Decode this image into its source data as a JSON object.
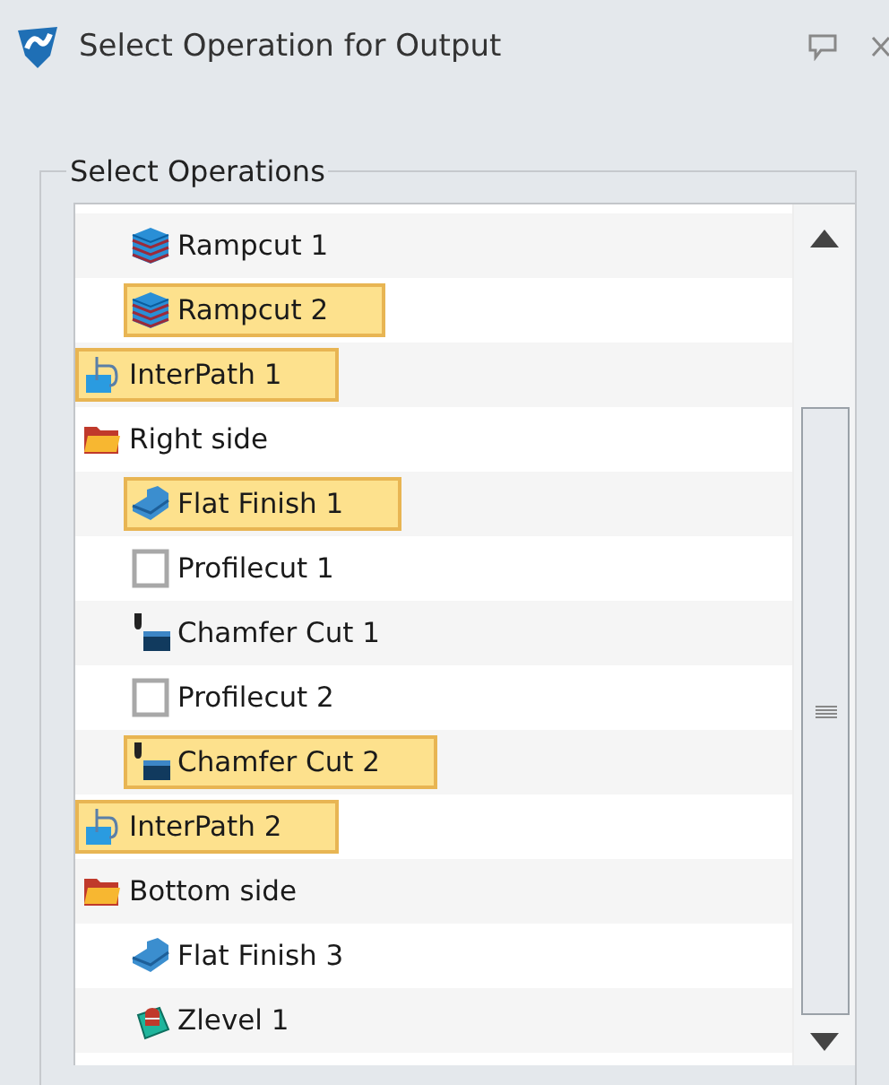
{
  "window": {
    "title": "Select Operation for Output"
  },
  "group": {
    "title": "Select Operations"
  },
  "tree": [
    {
      "children": [
        {
          "label": "Rampcut 1",
          "kind": "ramp",
          "selected": false
        },
        {
          "label": "Rampcut 2",
          "kind": "ramp",
          "selected": true
        }
      ]
    },
    {
      "label": "InterPath 1",
      "kind": "interpath",
      "selected": true
    },
    {
      "label": "Right side",
      "kind": "folder",
      "selected": false,
      "children": [
        {
          "label": "Flat Finish 1",
          "kind": "flat",
          "selected": true
        },
        {
          "label": "Profilecut 1",
          "kind": "profile",
          "selected": false
        },
        {
          "label": "Chamfer Cut 1",
          "kind": "chamfer",
          "selected": false
        },
        {
          "label": "Profilecut 2",
          "kind": "profile",
          "selected": false
        },
        {
          "label": "Chamfer Cut 2",
          "kind": "chamfer",
          "selected": true
        }
      ]
    },
    {
      "label": "InterPath 2",
      "kind": "interpath",
      "selected": true
    },
    {
      "label": "Bottom side",
      "kind": "folder",
      "selected": false,
      "children": [
        {
          "label": "Flat Finish 3",
          "kind": "flat",
          "selected": false
        },
        {
          "label": "Zlevel 1",
          "kind": "zlevel",
          "selected": false
        }
      ]
    }
  ]
}
